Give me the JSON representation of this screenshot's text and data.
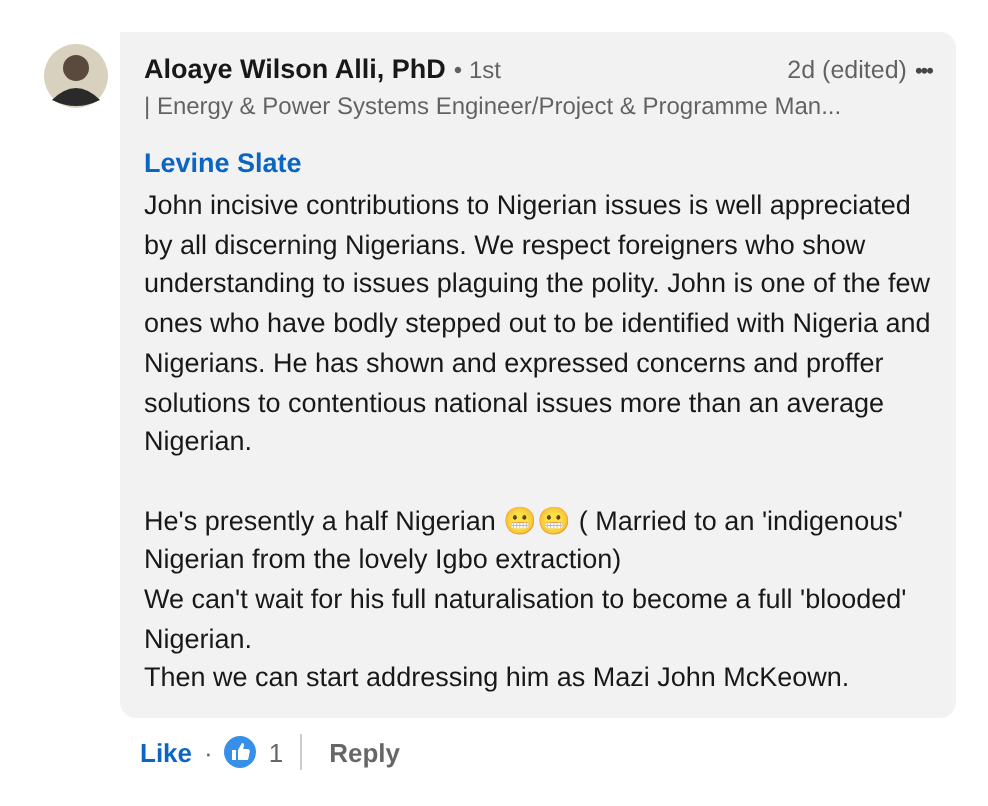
{
  "comment": {
    "author": "Aloaye Wilson Alli, PhD",
    "degree": "• 1st",
    "time": "2d (edited)",
    "more": "•••",
    "headline": "| Energy & Power Systems Engineer/Project & Programme Man...",
    "mention": "Levine Slate",
    "body": "John incisive contributions to Nigerian issues is well appreciated by all discerning Nigerians. We respect foreigners who show understanding to issues plaguing the polity. John is one of the few ones who have bodly stepped out to be identified with Nigeria and Nigerians.  He has shown and expressed concerns and proffer solutions to contentious national issues more than an average Nigerian.\n\n He's presently a half Nigerian 😬😬 ( Married to an 'indigenous' Nigerian from the lovely Igbo extraction)\nWe can't wait for his full naturalisation to become a full 'blooded' Nigerian.\nThen we can start addressing him as Mazi John McKeown."
  },
  "actions": {
    "like": "Like",
    "separator": "·",
    "reaction_count": "1",
    "reply": "Reply"
  }
}
